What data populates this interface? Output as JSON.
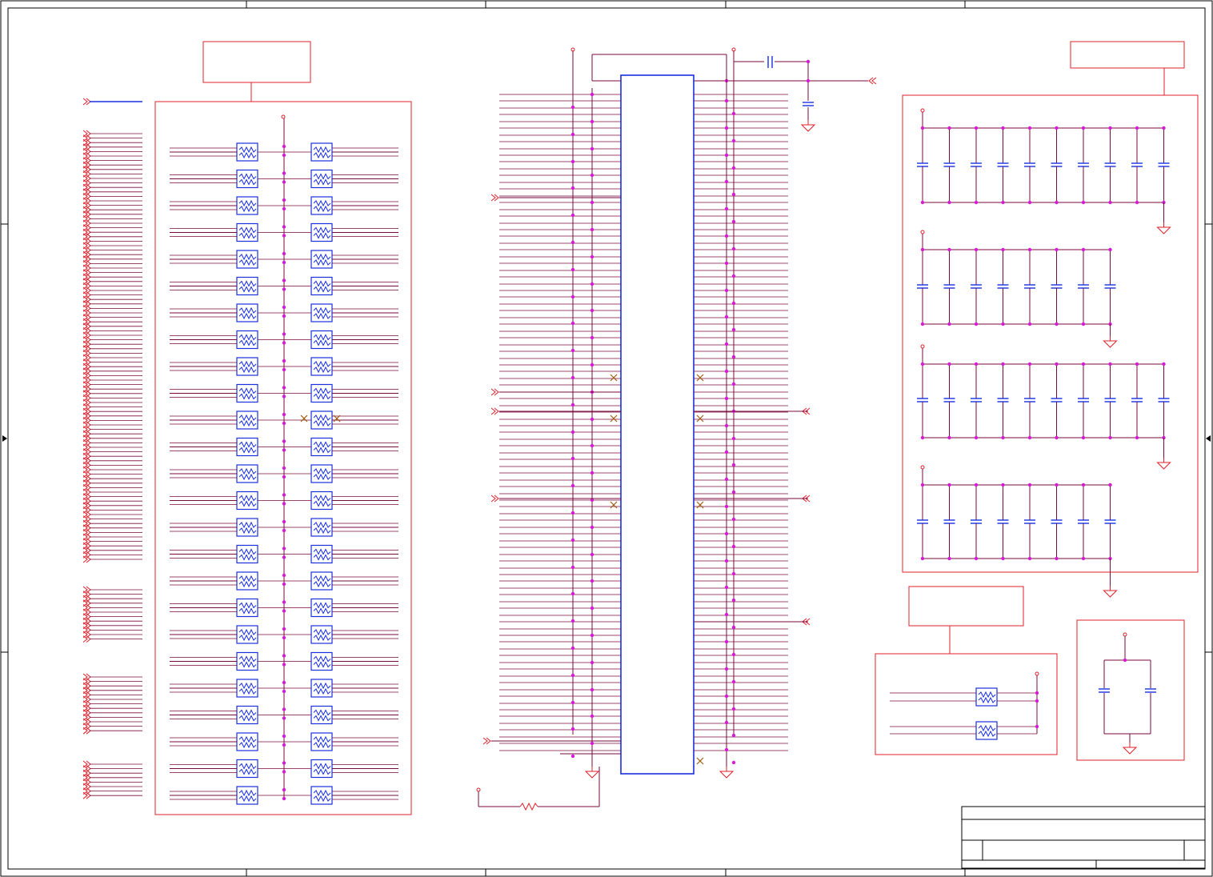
{
  "schematic": {
    "sheet": {
      "border_color": "#000000"
    },
    "colors": {
      "wire": "#7a0a3c",
      "port": "#e0202a",
      "component": "#1a2fe0",
      "junction": "#d61ad6",
      "no_connect": "#a05a10",
      "block_outline": "#e0202a"
    },
    "title_block": {
      "title": "",
      "sheet": "",
      "rev": ""
    },
    "blocks": [
      {
        "name": "resistor-network-block",
        "label": ""
      },
      {
        "name": "connector-block",
        "label": ""
      },
      {
        "name": "decoupling-capacitor-block",
        "label": ""
      },
      {
        "name": "small-resistor-block",
        "label": ""
      },
      {
        "name": "bulk-capacitor-block",
        "label": ""
      }
    ]
  }
}
